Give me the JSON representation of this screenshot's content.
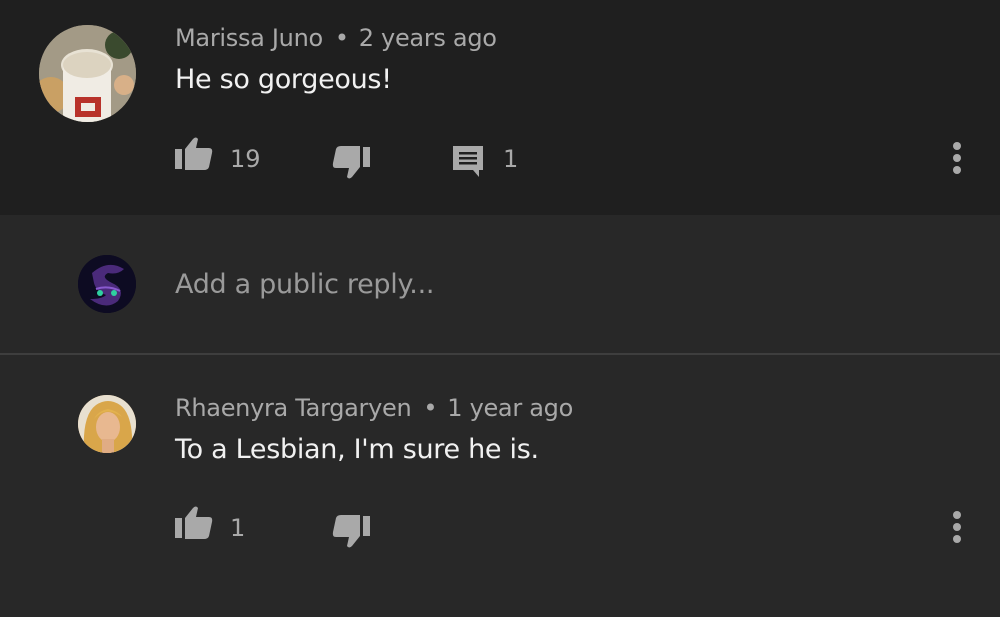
{
  "comment": {
    "author": "Marissa Juno",
    "separator": "•",
    "time": "2 years ago",
    "text": "He so gorgeous!",
    "likes": "19",
    "replies": "1"
  },
  "reply_box": {
    "placeholder": "Add a public reply..."
  },
  "reply": {
    "author": "Rhaenyra Targaryen",
    "separator": "•",
    "time": "1 year ago",
    "text": "To a Lesbian, I'm sure he is.",
    "likes": "1"
  },
  "colors": {
    "main_comment_bg": "#1f1f1f",
    "thread_bg": "#282828",
    "icon": "#a9a9a9",
    "primary_text": "#f1f1f1",
    "secondary_text": "#a9a9a9"
  }
}
